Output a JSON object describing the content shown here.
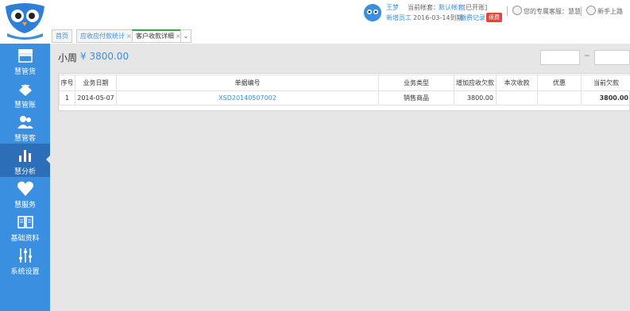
{
  "header": {
    "user_name": "王梦",
    "account_label": "当前帐套：",
    "account_name": "默认帐套",
    "account_status": "[已开账]",
    "staff_link": "新增员工",
    "expire": "2016-03-14到期",
    "pay_link": "缴费记录",
    "renew_badge": "续费",
    "service_text": "您的专属客服：慧慧",
    "guide_text": "新手上路"
  },
  "tabs": [
    {
      "label": "首页",
      "close": ""
    },
    {
      "label": "应收应付款统计",
      "close": "×"
    },
    {
      "label": "客户收款详细",
      "close": "×"
    }
  ],
  "tab_more": "⌄",
  "sidebar": {
    "items": [
      {
        "label": "慧管货",
        "icon": "store-icon"
      },
      {
        "label": "慧管账",
        "icon": "ledger-icon"
      },
      {
        "label": "慧管客",
        "icon": "customers-icon"
      },
      {
        "label": "慧分析",
        "icon": "bar-chart-icon"
      },
      {
        "label": "慧服务",
        "icon": "heart-icon"
      },
      {
        "label": "基础资料",
        "icon": "book-icon"
      },
      {
        "label": "系统设置",
        "icon": "sliders-icon"
      }
    ]
  },
  "main": {
    "customer_name": "小周",
    "amount": "¥ 3800.00",
    "date_sep": "~",
    "table": {
      "columns": [
        "序号",
        "业务日期",
        "单据编号",
        "业务类型",
        "增加应收欠款",
        "本次收款",
        "优惠",
        "当前欠款"
      ],
      "rows": [
        [
          "1",
          "2014-05-07",
          "XSD20140507002",
          "销售商品",
          "3800.00",
          "",
          "",
          "3800.00"
        ]
      ]
    }
  }
}
